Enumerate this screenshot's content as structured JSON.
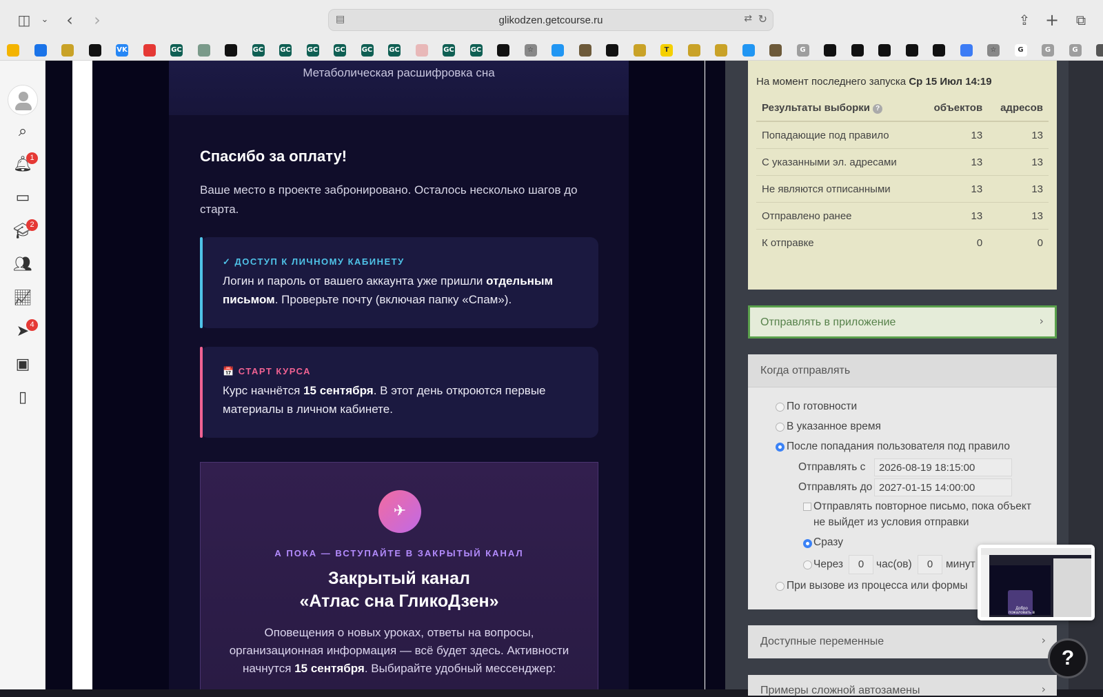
{
  "browser": {
    "url": "glikodzen.getcourse.ru"
  },
  "bookmarks": [
    {
      "label": "",
      "color": "#f4b400"
    },
    {
      "label": "",
      "color": "#1a73e8"
    },
    {
      "label": "",
      "color": "#c9a227"
    },
    {
      "label": "",
      "color": "#111111"
    },
    {
      "label": "VK",
      "color": "#2787f5"
    },
    {
      "label": "",
      "color": "#e53935"
    },
    {
      "label": "GC",
      "color": "#0f5f53"
    },
    {
      "label": "",
      "color": "#7a9a8a"
    },
    {
      "label": "",
      "color": "#111111"
    },
    {
      "label": "GC",
      "color": "#0f5f53"
    },
    {
      "label": "GC",
      "color": "#0f5f53"
    },
    {
      "label": "GC",
      "color": "#0f5f53"
    },
    {
      "label": "GC",
      "color": "#0f5f53"
    },
    {
      "label": "GC",
      "color": "#0f5f53"
    },
    {
      "label": "GC",
      "color": "#0f5f53"
    },
    {
      "label": "",
      "color": "#e8b8b8"
    },
    {
      "label": "GC",
      "color": "#0f5f53"
    },
    {
      "label": "GC",
      "color": "#0f5f53"
    },
    {
      "label": "",
      "color": "#111111"
    },
    {
      "label": "☆",
      "color": "#888888"
    },
    {
      "label": "",
      "color": "#2196f3"
    },
    {
      "label": "",
      "color": "#6d5a3a"
    },
    {
      "label": "",
      "color": "#111111"
    },
    {
      "label": "",
      "color": "#c9a227"
    },
    {
      "label": "T",
      "color": "#f5d000"
    },
    {
      "label": "",
      "color": "#c9a227"
    },
    {
      "label": "",
      "color": "#c9a227"
    },
    {
      "label": "",
      "color": "#2196f3"
    },
    {
      "label": "",
      "color": "#6d5a3a"
    },
    {
      "label": "G",
      "color": "#9e9e9e"
    },
    {
      "label": "",
      "color": "#111111"
    },
    {
      "label": "",
      "color": "#111111"
    },
    {
      "label": "",
      "color": "#111111"
    },
    {
      "label": "",
      "color": "#111111"
    },
    {
      "label": "",
      "color": "#111111"
    },
    {
      "label": "",
      "color": "#3d7cf5"
    },
    {
      "label": "☆",
      "color": "#888888"
    },
    {
      "label": "G",
      "color": "#ffffff"
    },
    {
      "label": "G",
      "color": "#9e9e9e"
    },
    {
      "label": "G",
      "color": "#9e9e9e"
    },
    {
      "label": "",
      "color": "#555555"
    }
  ],
  "sidebar": {
    "notifications_badge": "1",
    "learning_badge": "2",
    "messages_badge": "4"
  },
  "email": {
    "header_title": "Метаболическая расшифровка сна",
    "thanks_title": "Спасибо за оплату!",
    "intro": "Ваше место в проекте забронировано. Осталось несколько шагов до старта.",
    "access_block": {
      "label": "✓ ДОСТУП К ЛИЧНОМУ КАБИНЕТУ",
      "text_a": "Логин и пароль от вашего аккаунта уже пришли ",
      "text_bold": "отдельным письмом",
      "text_b": ". Проверьте почту (включая папку «Спам»).",
      "accent": "#4fc3e8"
    },
    "start_block": {
      "label": "📅 СТАРТ КУРСА",
      "text_a": "Курс начнётся ",
      "text_bold": "15 сентября",
      "text_b": ". В этот день откроются первые материалы в личном кабинете.",
      "accent": "#f06292"
    },
    "channel": {
      "label": "А ПОКА — ВСТУПАЙТЕ В ЗАКРЫТЫЙ КАНАЛ",
      "title_line1": "Закрытый канал",
      "title_line2": "«Атлас сна ГликоДзен»",
      "desc_a": "Оповещения о новых уроках, ответы на вопросы, организационная информация — всё будет здесь. Активности начнутся ",
      "desc_bold": "15 сентября",
      "desc_b": ". Выбирайте удобный мессенджер:"
    }
  },
  "stats": {
    "caption_prefix": "На момент последнего запуска ",
    "caption_date": "Ср 15 Июл 14:19",
    "columns": [
      "Результаты выборки",
      "объектов",
      "адресов"
    ],
    "rows": [
      [
        "Попадающие под правило",
        "13",
        "13"
      ],
      [
        "С указанными эл. адресами",
        "13",
        "13"
      ],
      [
        "Не являются отписанными",
        "13",
        "13"
      ],
      [
        "Отправлено ранее",
        "13",
        "13"
      ],
      [
        "К отправке",
        "0",
        "0"
      ]
    ]
  },
  "send_app": {
    "label": "Отправлять в приложение"
  },
  "when": {
    "title": "Когда отправлять",
    "opt_ready": "По готовности",
    "opt_time": "В указанное время",
    "opt_after": "После попадания пользователя под правило",
    "send_from_label": "Отправлять с",
    "send_from_value": "2026-08-19 18:15:00",
    "send_to_label": "Отправлять до",
    "send_to_value": "2027-01-15 14:00:00",
    "repeat_label_1": "Отправлять повторное письмо, пока объект",
    "repeat_label_2": "не выйдет из условия отправки",
    "opt_now": "Сразу",
    "opt_after_label": "Через",
    "hours_value": "0",
    "hours_label": "час(ов)",
    "minutes_value": "0",
    "minutes_label": "минут",
    "opt_process": "При вызове из процесса или формы"
  },
  "vars": {
    "title": "Доступные переменные"
  },
  "examples": {
    "title": "Примеры сложной автозамены"
  },
  "thumbnail": {
    "caption": "Добро пожаловать в"
  },
  "help": {
    "label": "?"
  }
}
